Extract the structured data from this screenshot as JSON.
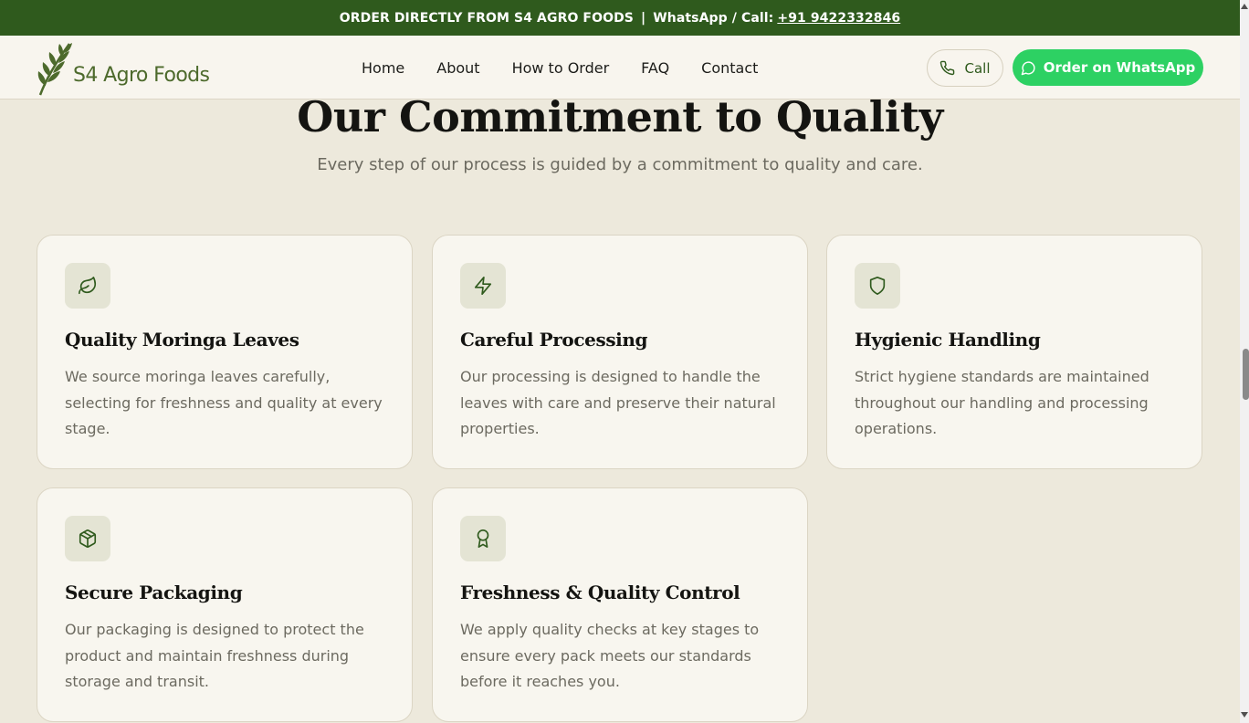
{
  "topbar": {
    "order_text": "ORDER DIRECTLY FROM S4 AGRO FOODS",
    "separator": "|",
    "contact_prefix": "WhatsApp / Call:",
    "phone": "+91 9422332846"
  },
  "header": {
    "logo_text": "S4 Agro Foods",
    "nav": [
      {
        "label": "Home"
      },
      {
        "label": "About"
      },
      {
        "label": "How to Order"
      },
      {
        "label": "FAQ"
      },
      {
        "label": "Contact"
      }
    ],
    "call_label": "Call",
    "whatsapp_label": "Order on WhatsApp"
  },
  "section": {
    "title": "Our Commitment to Quality",
    "subtitle": "Every step of our process is guided by a commitment to quality and care."
  },
  "cards": [
    {
      "icon": "leaf-icon",
      "title": "Quality Moringa Leaves",
      "text": "We source moringa leaves carefully, selecting for freshness and quality at every stage."
    },
    {
      "icon": "lightning-icon",
      "title": "Careful Processing",
      "text": "Our processing is designed to handle the leaves with care and preserve their natural properties."
    },
    {
      "icon": "shield-icon",
      "title": "Hygienic Handling",
      "text": "Strict hygiene standards are maintained throughout our handling and processing operations."
    },
    {
      "icon": "package-icon",
      "title": "Secure Packaging",
      "text": "Our packaging is designed to protect the product and maintain freshness during storage and transit."
    },
    {
      "icon": "award-icon",
      "title": "Freshness & Quality Control",
      "text": "We apply quality checks at key stages to ensure every pack meets our standards before it reaches you."
    }
  ],
  "colors": {
    "brand_green": "#2f5a1d",
    "whatsapp_green": "#2dd163",
    "background": "#ede9dc",
    "card_background": "#f8f6ef"
  }
}
